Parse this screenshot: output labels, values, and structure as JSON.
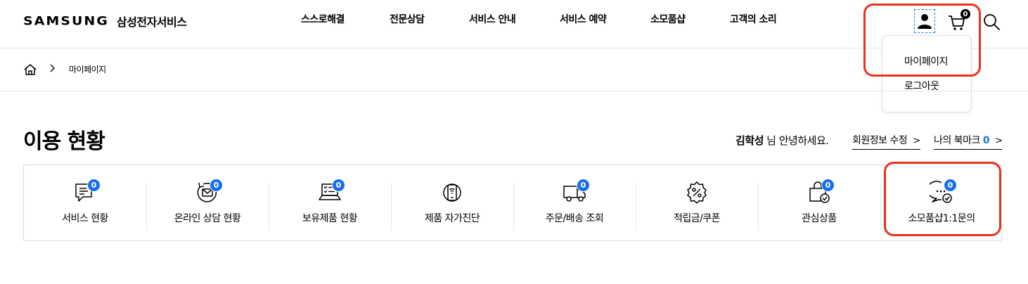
{
  "header": {
    "logo": "SAMSUNG",
    "logo_sub": "삼성전자서비스",
    "nav": [
      "스스로해결",
      "전문상담",
      "서비스 안내",
      "서비스 예약",
      "소모품샵",
      "고객의 소리"
    ],
    "cart_count": "0",
    "user_menu": [
      "마이페이지",
      "로그아웃"
    ]
  },
  "breadcrumb": {
    "current": "마이페이지"
  },
  "page": {
    "title": "이용 현황",
    "user_name": "김학성",
    "greeting_suffix": " 님 안녕하세요.",
    "edit_profile": "회원정보 수정",
    "bookmark_label": "나의 북마크",
    "bookmark_count": "0"
  },
  "status_items": [
    {
      "label": "서비스 현황",
      "icon": "service-chat-icon",
      "badge": "0"
    },
    {
      "label": "온라인 상담 현황",
      "icon": "online-consult-icon",
      "badge": "0"
    },
    {
      "label": "보유제품 현황",
      "icon": "owned-product-laptop-icon",
      "badge": "0"
    },
    {
      "label": "제품 자가진단",
      "icon": "self-diagnosis-icon",
      "badge": ""
    },
    {
      "label": "주문/배송 조회",
      "icon": "delivery-truck-icon",
      "badge": "0"
    },
    {
      "label": "적립금/쿠폰",
      "icon": "coupon-percent-icon",
      "badge": ""
    },
    {
      "label": "관심상품",
      "icon": "wishlist-bag-icon",
      "badge": "0"
    },
    {
      "label": "소모품샵1:1문의",
      "icon": "inquiry-bubble-icon",
      "badge": "0"
    }
  ],
  "colors": {
    "accent": "#1a6fe8",
    "highlight": "#e8321e"
  }
}
